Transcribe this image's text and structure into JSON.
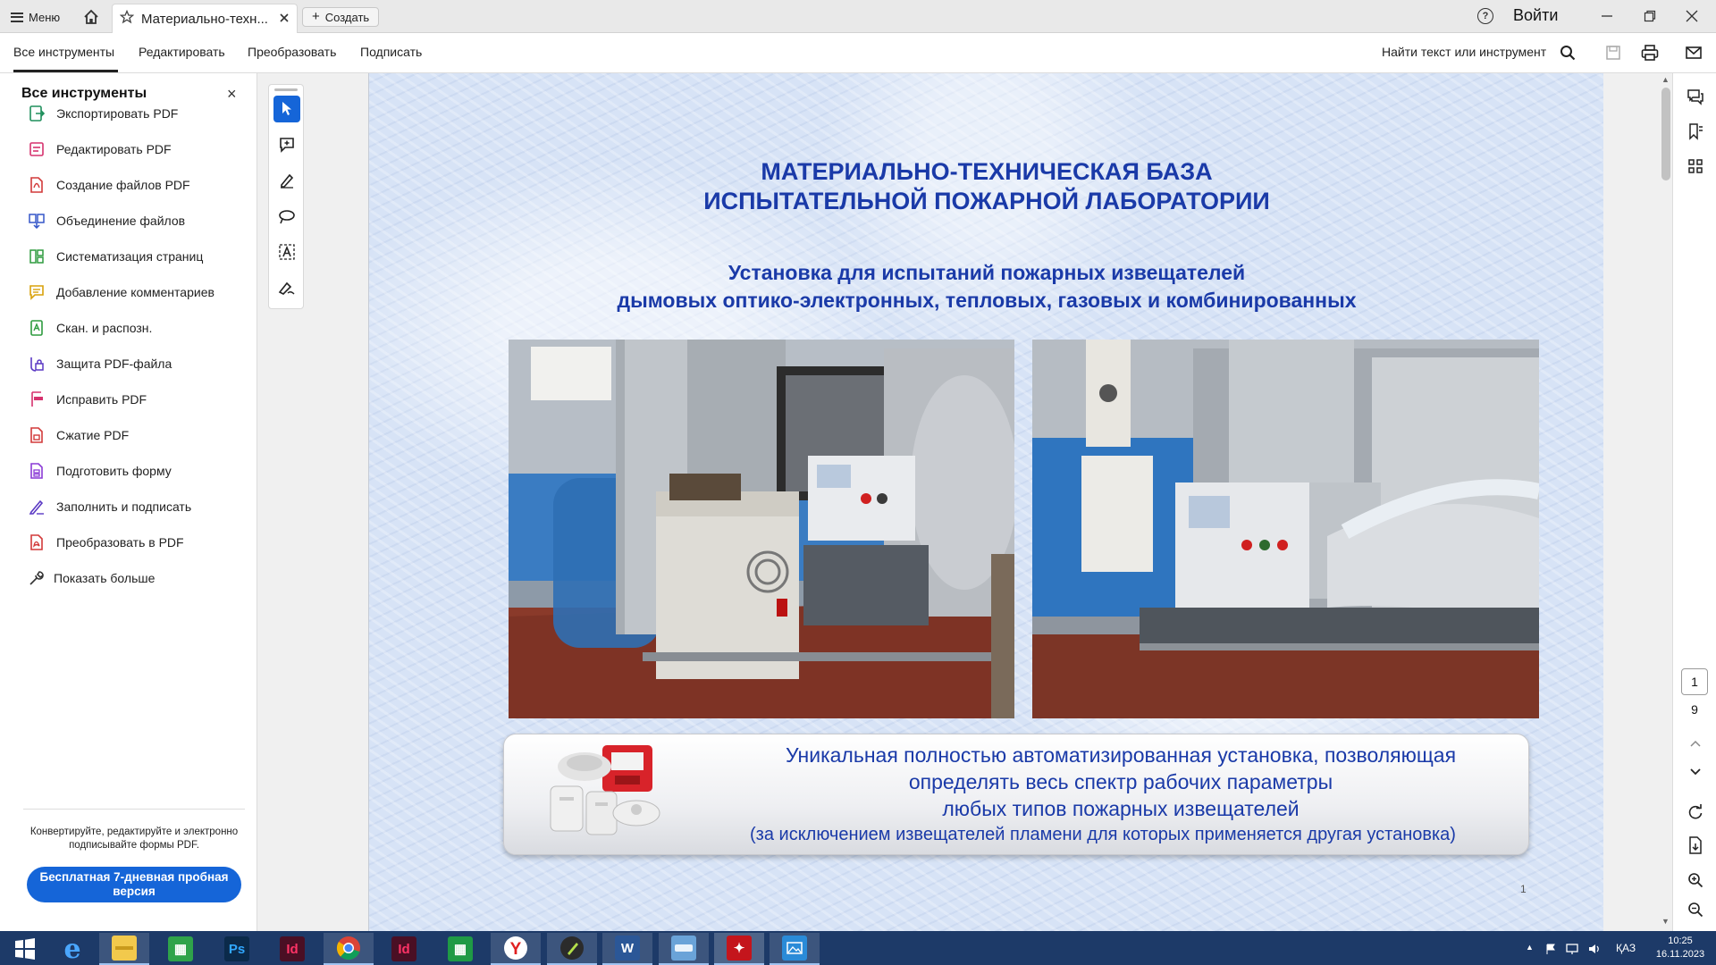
{
  "titlebar": {
    "menu_label": "Меню",
    "tab_title": "Материально-техн...",
    "create_label": "Создать",
    "help": "?",
    "signin_label": "Войти"
  },
  "toolbar": {
    "tabs": [
      "Все инструменты",
      "Редактировать",
      "Преобразовать",
      "Подписать"
    ],
    "find_label": "Найти текст или инструмент"
  },
  "left_panel": {
    "title": "Все инструменты",
    "close": "×",
    "items": [
      {
        "label": "Экспортировать PDF",
        "icon": "export-pdf-icon",
        "color": "#1f8f5c"
      },
      {
        "label": "Редактировать PDF",
        "icon": "edit-pdf-icon",
        "color": "#d6326e"
      },
      {
        "label": "Создание файлов PDF",
        "icon": "create-pdf-icon",
        "color": "#d23a3a"
      },
      {
        "label": "Объединение файлов",
        "icon": "combine-files-icon",
        "color": "#3557c9"
      },
      {
        "label": "Систематизация страниц",
        "icon": "organize-pages-icon",
        "color": "#2e9b3f"
      },
      {
        "label": "Добавление комментариев",
        "icon": "comment-icon",
        "color": "#d9a20b"
      },
      {
        "label": "Скан. и распозн.",
        "icon": "scan-icon",
        "color": "#2e9b3f"
      },
      {
        "label": "Защита PDF-файла",
        "icon": "protect-icon",
        "color": "#5b39c4"
      },
      {
        "label": "Исправить PDF",
        "icon": "redact-icon",
        "color": "#d6326e"
      },
      {
        "label": "Сжатие PDF",
        "icon": "compress-icon",
        "color": "#d23a3a"
      },
      {
        "label": "Подготовить форму",
        "icon": "prepare-form-icon",
        "color": "#8a3ad6"
      },
      {
        "label": "Заполнить и подписать",
        "icon": "fill-sign-icon",
        "color": "#5b39c4"
      },
      {
        "label": "Преобразовать в PDF",
        "icon": "convert-pdf-icon",
        "color": "#d23a3a"
      },
      {
        "label": "Показать больше",
        "icon": "wrench-icon",
        "color": "#333333"
      }
    ],
    "promo": "Конвертируйте, редактируйте и электронно подписывайте формы PDF.",
    "trial_label": "Бесплатная 7-дневная пробная версия"
  },
  "document": {
    "heading_line1": "МАТЕРИАЛЬНО-ТЕХНИЧЕСКАЯ БАЗА",
    "heading_line2": "ИСПЫТАТЕЛЬНОЙ ПОЖАРНОЙ ЛАБОРАТОРИИ",
    "subheading_line1": "Установка для испытаний пожарных извещателей",
    "subheading_line2": "дымовых оптико-электронных, тепловых, газовых и комбинированных",
    "caption_line1": "Уникальная полностью автоматизированная установка, позволяющая",
    "caption_line2": "определять весь спектр рабочих параметры",
    "caption_line3": "любых типов пожарных извещателей",
    "caption_line4": "(за исключением извещателей пламени для которых применяется другая установка)",
    "corner_mark": "1"
  },
  "page_nav": {
    "current": "1",
    "total": "9"
  },
  "taskbar": {
    "apps": [
      "start",
      "internet-explorer",
      "file-explorer",
      "store",
      "photoshop",
      "indesign",
      "chrome",
      "indesign",
      "calculator",
      "yandex",
      "chess",
      "word",
      "scanner",
      "acrobat",
      "photos"
    ],
    "lang": "ҚАЗ",
    "time": "10:25",
    "date": "16.11.2023"
  },
  "colors": {
    "accent": "#1565d8",
    "doc_text": "#1a3aa8",
    "taskbar": "#1d3a68"
  }
}
